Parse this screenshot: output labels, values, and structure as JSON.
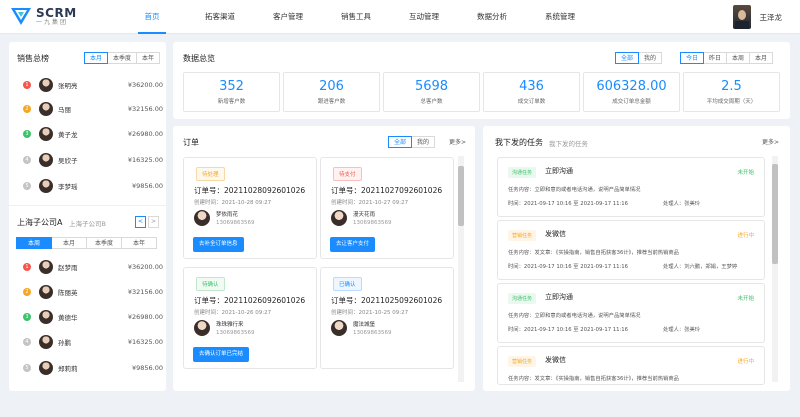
{
  "header": {
    "logo_main": "SCRM",
    "logo_sub": "一九集团",
    "nav": [
      "首页",
      "拓客渠道",
      "客户管理",
      "销售工具",
      "互动管理",
      "数据分析",
      "系统管理"
    ],
    "user_name": "王泽龙"
  },
  "sales_rank": {
    "title": "销售总榜",
    "tabs": [
      "本月",
      "本季度",
      "本年"
    ],
    "items": [
      {
        "rank": "1",
        "name": "张明亮",
        "value": "¥36200.00"
      },
      {
        "rank": "2",
        "name": "马丽",
        "value": "¥32156.00"
      },
      {
        "rank": "3",
        "name": "黄子龙",
        "value": "¥26980.00"
      },
      {
        "rank": "4",
        "name": "吴欣子",
        "value": "¥16325.00"
      },
      {
        "rank": "5",
        "name": "李梦瑶",
        "value": "¥9856.00"
      }
    ]
  },
  "company_rank": {
    "title": "上海子公司A",
    "alt": "上海子公司B",
    "prev": "<",
    "next": ">",
    "tabs": [
      "本周",
      "本月",
      "本季度",
      "本年"
    ],
    "items": [
      {
        "rank": "1",
        "name": "赵梦雨",
        "value": "¥36200.00"
      },
      {
        "rank": "2",
        "name": "陈丽英",
        "value": "¥32156.00"
      },
      {
        "rank": "3",
        "name": "黄德华",
        "value": "¥26980.00"
      },
      {
        "rank": "4",
        "name": "孙鹏",
        "value": "¥16325.00"
      },
      {
        "rank": "5",
        "name": "郑莉莉",
        "value": "¥9856.00"
      }
    ]
  },
  "overview": {
    "title": "数据总览",
    "scope_tabs": [
      "全部",
      "我的"
    ],
    "period_tabs": [
      "今日",
      "昨日",
      "本周",
      "本月"
    ],
    "stats": [
      {
        "value": "352",
        "label": "新增客户数"
      },
      {
        "value": "206",
        "label": "跟进客户数"
      },
      {
        "value": "5698",
        "label": "总客户数"
      },
      {
        "value": "436",
        "label": "成交订单数"
      },
      {
        "value": "606328.00",
        "label": "成交订单总金额"
      },
      {
        "value": "2.5",
        "label": "平均成交周期（天）"
      }
    ]
  },
  "orders": {
    "title": "订单",
    "tabs": [
      "全部",
      "我的"
    ],
    "more": "更多>",
    "cards": [
      {
        "tag": "待处理",
        "no": "订单号：20211028092601026",
        "time": "创建时间：2021-10-28 09:27",
        "name": "梦依雨花",
        "phone": "13069863569",
        "btn": "去补全订单信息"
      },
      {
        "tag": "待支付",
        "no": "订单号：20211027092601026",
        "time": "创建时间：2021-10-27 09:27",
        "name": "漫天花雨",
        "phone": "13069863569",
        "btn": "去让客户支付"
      },
      {
        "tag": "待确认",
        "no": "订单号：20211026092601026",
        "time": "创建时间：2021-10-26 09:27",
        "name": "珠珠雅行来",
        "phone": "13069863569",
        "btn": "去确认订单已完结"
      },
      {
        "tag": "已确认",
        "no": "订单号：20211025092601026",
        "time": "创建时间：2021-10-25 09:27",
        "name": "魔法城堡",
        "phone": "13069863569",
        "btn": ""
      }
    ]
  },
  "tasks": {
    "tabs": [
      "我下发的任务",
      "我下发的任务"
    ],
    "more": "更多>",
    "cards": [
      {
        "tag": "沟通任务",
        "title": "立即沟通",
        "status": "未开始",
        "content": "任务内容：立即和意向或者电话沟通，说明产品简单情况",
        "time": "时间：2021-09-17 10:16 至 2021-09-17 11:16",
        "person": "处理人：张美玲"
      },
      {
        "tag": "营销任务",
        "title": "发微信",
        "status": "进行中",
        "content": "任务内容：发文章：《实操指南，销售自拓获客36计》，推荐当前热销商品",
        "time": "时间：2021-09-17 10:16 至 2021-09-17 11:16",
        "person": "处理人：刘六鹏，郑娟，王梦婷"
      },
      {
        "tag": "沟通任务",
        "title": "立即沟通",
        "status": "未开始",
        "content": "任务内容：立即和意向或者电话沟通，说明产品简单情况",
        "time": "时间：2021-09-17 10:16 至 2021-09-17 11:16",
        "person": "处理人：张美玲"
      },
      {
        "tag": "营销任务",
        "title": "发微信",
        "status": "进行中",
        "content": "任务内容：发文章：《实操指南，销售自拓获客36计》，推荐当前热销商品",
        "time": "",
        "person": ""
      }
    ]
  },
  "colors": {
    "accent": "#1a8cff",
    "rank1": "#f5574f",
    "rank2": "#f5a623",
    "rank3": "#3dc26b",
    "rank_other": "#c4c4c4"
  }
}
